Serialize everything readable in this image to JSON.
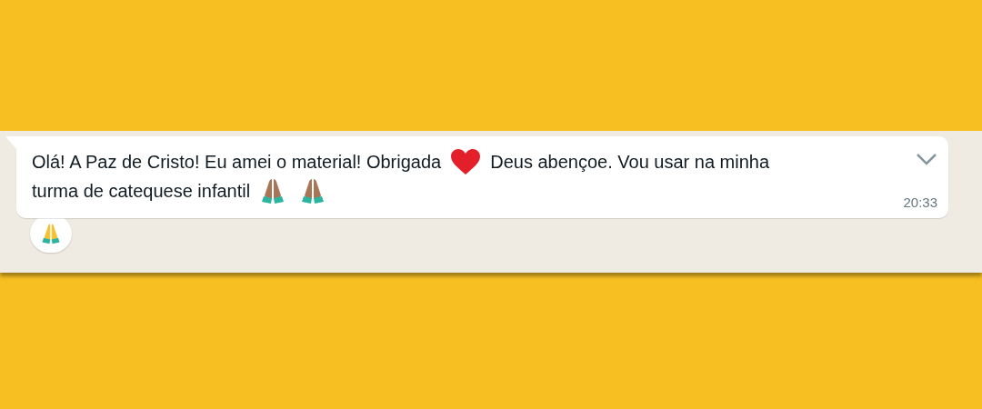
{
  "message": {
    "lines": [
      [
        {
          "kind": "text",
          "text": "Olá! A Paz de Cristo! Eu amei o material! Obrigada"
        },
        {
          "kind": "heart"
        },
        {
          "kind": "text",
          "text": "Deus abençoe. Vou usar na minha"
        }
      ],
      [
        {
          "kind": "text",
          "text": "turma de catequese infantil"
        },
        {
          "kind": "praying-hands"
        },
        {
          "kind": "praying-hands"
        }
      ]
    ],
    "time": "20:33",
    "reaction": {
      "kind": "praying-hands"
    }
  }
}
